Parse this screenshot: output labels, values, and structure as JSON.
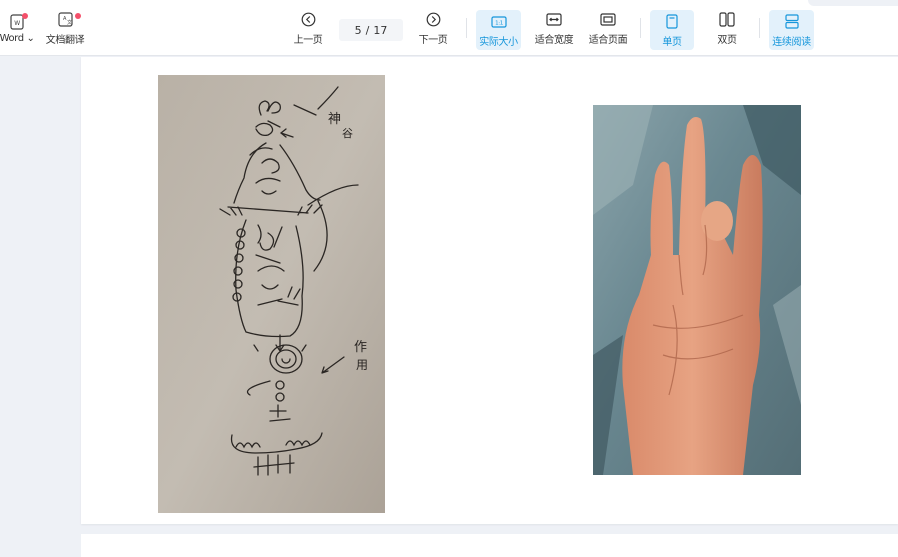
{
  "toolbar": {
    "word_label": "Word ⌄",
    "translate_label": "文档翻译",
    "prev_label": "上一页",
    "page_current": "5",
    "page_sep": "/",
    "page_total": "17",
    "next_label": "下一页",
    "actual_size_label": "实际大小",
    "fit_width_label": "适合宽度",
    "fit_page_label": "适合页面",
    "single_page_label": "单页",
    "double_page_label": "双页",
    "continuous_label": "连续阅读"
  },
  "sketch_labels": {
    "top_right": "神",
    "top_right2": "谷",
    "mid_right": "作",
    "mid_right2": "用"
  },
  "colors": {
    "accent": "#1596db",
    "active_bg": "#e3f1fb",
    "badge": "#f4506a"
  }
}
